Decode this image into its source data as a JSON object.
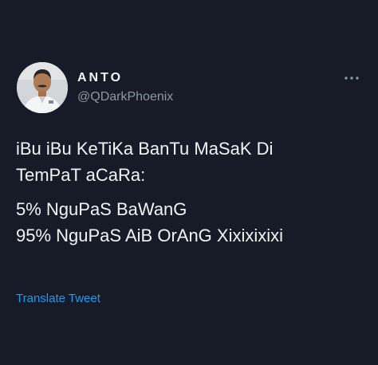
{
  "author": {
    "display_name": "ANTO",
    "handle": "@QDarkPhoenix",
    "avatar_icon": "profile-photo"
  },
  "menu": {
    "icon": "more-horizontal-icon"
  },
  "tweet": {
    "lines": [
      "iBu iBu KeTiKa BanTu MaSaK Di",
      "TemPaT aCaRa:",
      "5% NguPaS BaWanG",
      "95% NguPaS AiB OrAnG Xixixixixi"
    ]
  },
  "actions": {
    "translate_label": "Translate Tweet"
  },
  "colors": {
    "background": "#161b27",
    "text": "#f1f3f5",
    "secondary": "#8b98a5",
    "accent": "#1d9bf0"
  }
}
